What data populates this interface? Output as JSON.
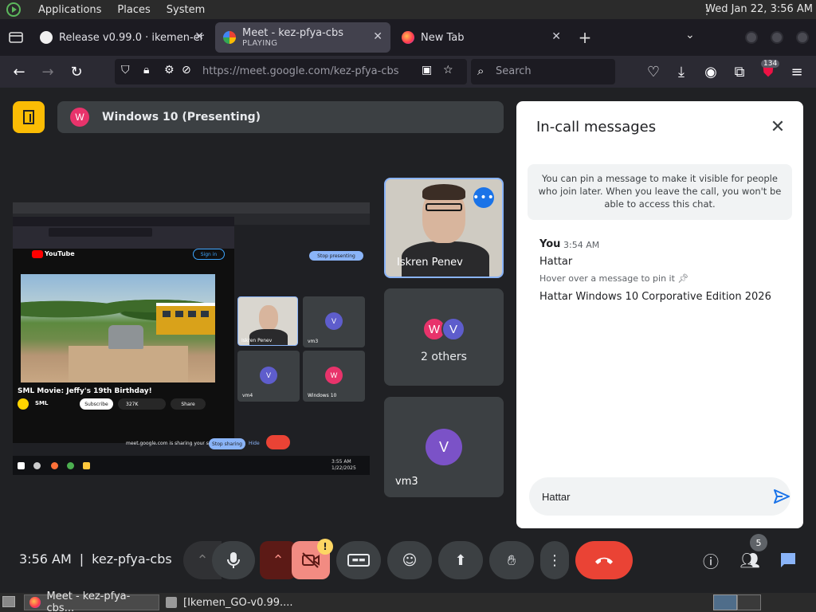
{
  "panel": {
    "menu": [
      "Applications",
      "Places",
      "System"
    ],
    "clock": "Wed Jan 22,  3:56 AM"
  },
  "browser": {
    "tabs": [
      {
        "title": "Release v0.99.0 · ikemen-er",
        "subtitle": "",
        "icon": "github-icon"
      },
      {
        "title": "Meet - kez-pfya-cbs",
        "subtitle": "PLAYING",
        "icon": "google-meet-icon"
      },
      {
        "title": "New Tab",
        "subtitle": "",
        "icon": "firefox-icon"
      }
    ],
    "url": "https://meet.google.com/kez-pfya-cbs",
    "search_placeholder": "Search",
    "extension_badge": "134"
  },
  "meet": {
    "presenter_initial": "W",
    "presenting_label": "Windows 10 (Presenting)",
    "tiles": [
      {
        "name": "Iskren Penev"
      },
      {
        "name": "2 others",
        "initials": [
          "W",
          "V"
        ]
      },
      {
        "name": "vm3",
        "initial": "V"
      }
    ],
    "time": "3:56 AM",
    "separator": "|",
    "code": "kez-pfya-cbs",
    "people_count": "5",
    "warning_mark": "!",
    "colors": {
      "accent": "#1a73e8",
      "end_call": "#ea4335",
      "camera_off": "#f28b82",
      "pink_avatar": "#e8336b",
      "purple_avatar": "#7b52c7",
      "yellow": "#fbbc04"
    }
  },
  "screen_share": {
    "video_title": "SML Movie: Jeffy's 19th Birthday!",
    "channel": "SML",
    "subscribe": "Subscribe",
    "likes": "327K",
    "share": "Share",
    "youtube": "YouTube",
    "signin": "Sign in",
    "stop_presenting": "Stop presenting",
    "stop_sharing": "Stop sharing",
    "hide": "Hide",
    "share_note": "meet.google.com is sharing your screen",
    "mini_tiles": [
      {
        "name": "Iskren Penev"
      },
      {
        "name": "vm3",
        "initial": "V"
      },
      {
        "name": "vm4",
        "initial": "V"
      },
      {
        "name": "Windows 10",
        "initial": "W"
      }
    ],
    "clock": "3:55 AM",
    "date": "1/22/2025"
  },
  "chat": {
    "title": "In-call messages",
    "pin_info": "You can pin a message to make it visible for people who join later. When you leave the call, you won't be able to access this chat.",
    "messages_sender": "You",
    "messages_time": "3:54 AM",
    "messages": [
      "Hattar",
      "Hattar Windows 10 Corporative Edition 2026"
    ],
    "hover_hint": "Hover over a message to pin it",
    "input_value": "Hattar"
  },
  "taskbar": {
    "tasks": [
      "Meet - kez-pfya-cbs...",
      "[Ikemen_GO-v0.99...."
    ]
  }
}
